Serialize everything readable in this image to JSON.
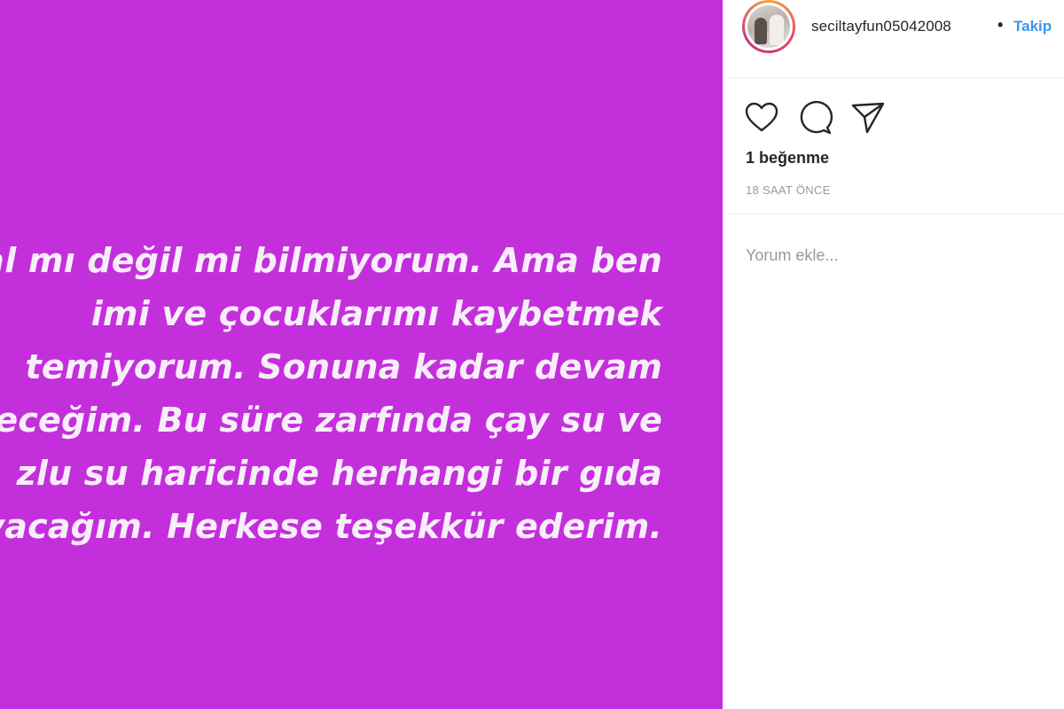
{
  "post": {
    "background_color": "#c42fdc",
    "text_color": "#f7eef9",
    "lines": [
      "sal mı değil mi bilmiyorum. Ama ben",
      "imi ve çocuklarımı kaybetmek",
      "temiyorum. Sonuna kadar devam",
      "eceğim. Bu süre zarfında çay su ve",
      "zlu su haricinde herhangi bir gıda",
      "nayacağım. Herkese teşekkür ederim."
    ]
  },
  "header": {
    "username": "seciltayfun05042008",
    "separator": "•",
    "follow_label": "Takip",
    "accent_color": "#3897f0"
  },
  "actions": {
    "icons": [
      "heart-icon",
      "comment-icon",
      "share-icon"
    ]
  },
  "likes": "1 beğenme",
  "timestamp": "18 SAAT ÖNCE",
  "comment": {
    "placeholder": "Yorum ekle..."
  }
}
